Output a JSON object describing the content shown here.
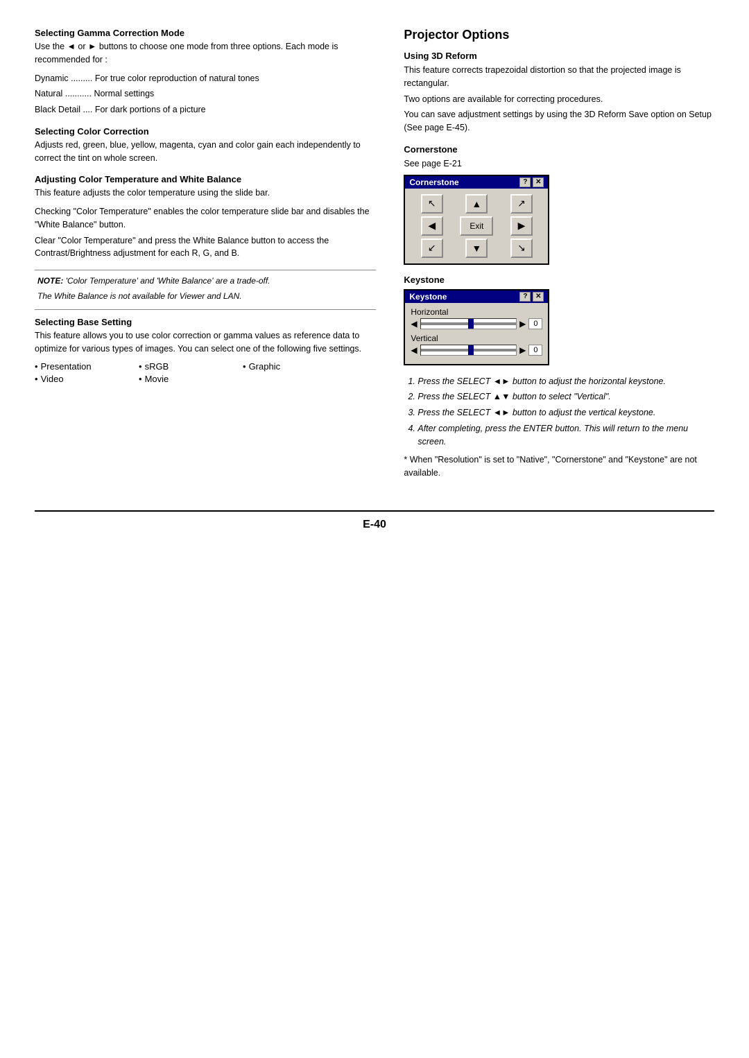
{
  "left": {
    "sections": [
      {
        "id": "gamma",
        "heading": "Selecting Gamma Correction Mode",
        "paragraphs": [
          "Use the ◄ or ► buttons to choose one mode from three options. Each mode is recommended for :",
          "",
          "Dynamic ......... For true color reproduction of natural tones",
          "Natural ........... Normal settings",
          "Black Detail .... For dark portions of a picture"
        ]
      },
      {
        "id": "color-correction",
        "heading": "Selecting Color Correction",
        "paragraphs": [
          "Adjusts red, green, blue, yellow, magenta, cyan and color gain each independently to correct the tint on whole screen."
        ]
      },
      {
        "id": "color-temp",
        "heading": "Adjusting Color Temperature and White Balance",
        "paragraphs": [
          "This feature adjusts the color temperature using the slide bar.",
          "",
          "Checking \"Color Temperature\" enables the color temperature slide bar and disables the \"White Balance\" button.",
          "Clear \"Color Temperature\" and press the White Balance button to access the Contrast/Brightness adjustment for each R, G, and B."
        ]
      },
      {
        "id": "note",
        "note_bold": "NOTE: 'Color Temperature' and 'White Balance' are a trade-off.",
        "note_italic": "The White Balance is not available for Viewer and LAN."
      },
      {
        "id": "base-setting",
        "heading": "Selecting Base Setting",
        "paragraphs": [
          "This feature allows you to use color correction or gamma values as reference data to optimize for various types of images. You can select one of the following five settings."
        ],
        "bullets": [
          {
            "text": "Presentation"
          },
          {
            "text": "sRGB"
          },
          {
            "text": "Graphic"
          },
          {
            "text": "Video"
          },
          {
            "text": "Movie"
          }
        ]
      }
    ]
  },
  "right": {
    "page_title": "Projector Options",
    "sections": [
      {
        "id": "3d-reform",
        "heading": "Using 3D Reform",
        "paragraphs": [
          "This feature corrects trapezoidal distortion so that the projected image is rectangular.",
          "Two options are available for correcting procedures.",
          "You can save adjustment settings by using the 3D Reform Save option on Setup (See page E-45)."
        ]
      },
      {
        "id": "cornerstone",
        "heading": "Cornerstone",
        "sub_text": "See page E-21",
        "dialog": {
          "title": "Cornerstone",
          "btns": [
            "?",
            "X"
          ],
          "grid": [
            [
              "↖",
              "▲",
              "↗"
            ],
            [
              "◄",
              "Exit",
              "►"
            ],
            [
              "↙",
              "▼",
              "↘"
            ]
          ]
        }
      },
      {
        "id": "keystone",
        "heading": "Keystone",
        "dialog": {
          "title": "Keystone",
          "btns": [
            "?",
            "X"
          ],
          "rows": [
            {
              "label": "Horizontal",
              "value": "0"
            },
            {
              "label": "Vertical",
              "value": "0"
            }
          ]
        }
      }
    ],
    "numbered_list": [
      "Press the SELECT ◄► button to adjust the horizontal keystone.",
      "Press the SELECT ▲▼ button to select \"Vertical\".",
      "Press the SELECT ◄► button to adjust the vertical keystone.",
      "After completing, press the ENTER button. This will return to the menu screen."
    ],
    "footnote": "* When \"Resolution\" is set to \"Native\", \"Cornerstone\" and \"Keystone\" are not available."
  },
  "page_number": "E-40"
}
